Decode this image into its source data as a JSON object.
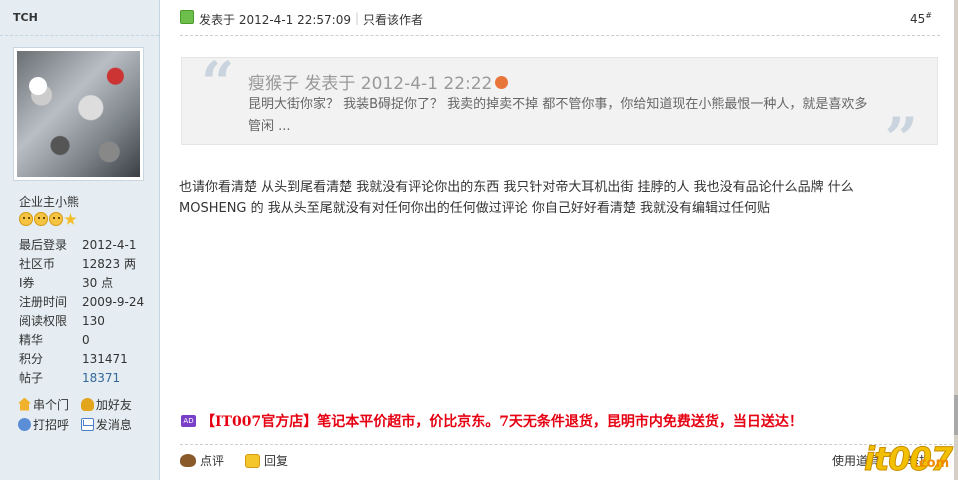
{
  "user": {
    "name": "TCH",
    "rank": "企业主小熊",
    "stats": [
      {
        "label": "最后登录",
        "value": "2012-4-1"
      },
      {
        "label": "社区币",
        "value": "12823 两"
      },
      {
        "label": "I券",
        "value": "30 点"
      },
      {
        "label": "注册时间",
        "value": "2009-9-24"
      },
      {
        "label": "阅读权限",
        "value": "130"
      },
      {
        "label": "精华",
        "value": "0"
      },
      {
        "label": "积分",
        "value": "131471"
      },
      {
        "label": "帖子",
        "value": "18371"
      }
    ],
    "actions": {
      "visit": "串个门",
      "add_friend": "加好友",
      "greet": "打招呼",
      "message": "发消息"
    },
    "star_icons": [
      "smiley-icon",
      "smiley-icon",
      "smiley-icon",
      "star-icon"
    ]
  },
  "post": {
    "posted_at": "发表于 2012-4-1 22:57:09",
    "separator": "|",
    "author_only": "只看该作者",
    "floor": "45",
    "floor_mark": "#",
    "quote": {
      "author_line": "瘦猴子 发表于 2012-4-1 22:22",
      "text": "昆明大街你家？ 我装B碍捉你了？ 我卖的掉卖不掉 都不管你事，你给知道现在小熊最恨一种人，就是喜欢多管闲 ..."
    },
    "body": "也请你看清楚 从头到尾看清楚 我就没有评论你出的东西 我只针对帝大耳机出街 挂脖的人 我也没有品论什么品牌 什么 MOSHENG 的 我从头至尾就没有对任何你出的任何做过评论 你自己好好看清楚 我就没有编辑过任何贴",
    "ad": {
      "badge": "AD",
      "text": "【IT007官方店】笔记本平价超市，价比京东。7天无条件退货，昆明市内免费送货，当日送达！"
    },
    "footer": {
      "comment": "点评",
      "reply": "回复",
      "tools": "使用道具",
      "report": "举报"
    }
  },
  "logo": {
    "main": "it007",
    "suffix": ".com"
  },
  "colors": {
    "sidebar_bg": "#e5edf2",
    "ad_red": "#e60012",
    "link_blue": "#336699",
    "quote_bg": "#f2f2f2"
  }
}
